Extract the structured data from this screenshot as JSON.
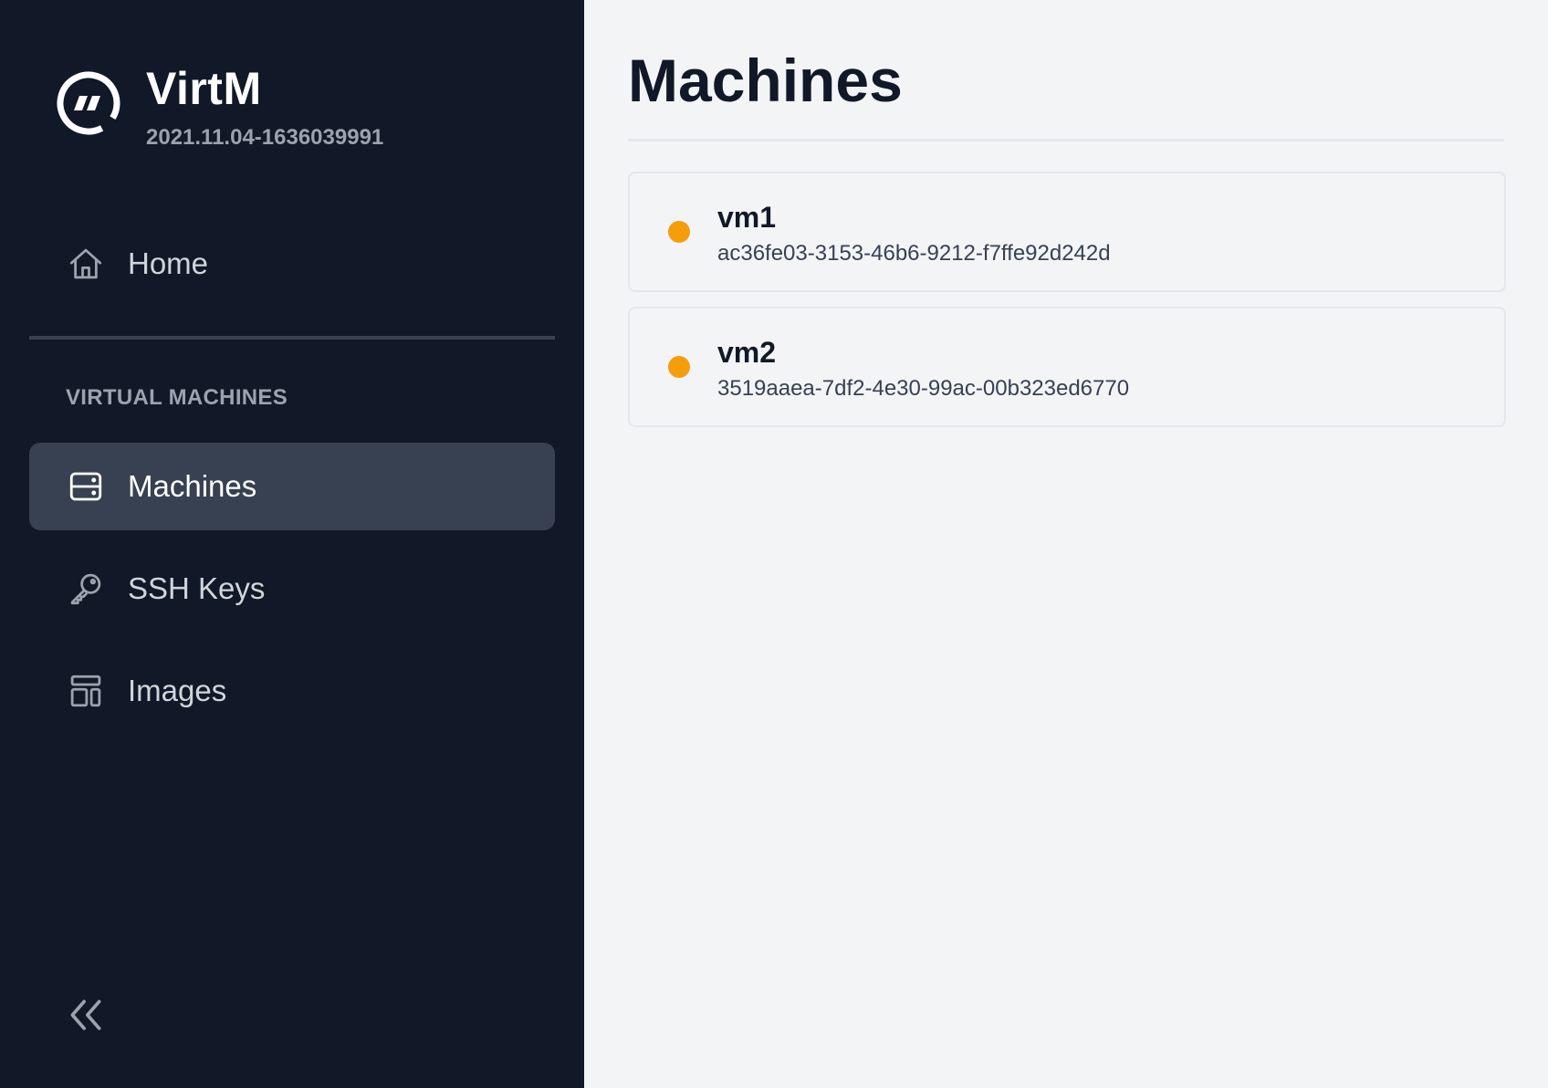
{
  "brand": {
    "name": "VirtM",
    "version": "2021.11.04-1636039991",
    "logo_icon": "virtm-logo-icon"
  },
  "sidebar": {
    "home": {
      "label": "Home",
      "icon": "home-icon"
    },
    "section_title": "VIRTUAL MACHINES",
    "items": [
      {
        "label": "Machines",
        "icon": "server-icon",
        "active": true
      },
      {
        "label": "SSH Keys",
        "icon": "key-icon",
        "active": false
      },
      {
        "label": "Images",
        "icon": "template-icon",
        "active": false
      }
    ],
    "collapse_icon": "chevrons-left-icon"
  },
  "main": {
    "title": "Machines",
    "machines": [
      {
        "name": "vm1",
        "id": "ac36fe03-3153-46b6-9212-f7ffe92d242d",
        "status_color": "#f59e0b"
      },
      {
        "name": "vm2",
        "id": "3519aaea-7df2-4e30-99ac-00b323ed6770",
        "status_color": "#f59e0b"
      }
    ]
  },
  "colors": {
    "sidebar_bg": "#111827",
    "active_item_bg": "#374151",
    "main_bg": "#f3f4f6",
    "status_pending": "#f59e0b"
  }
}
